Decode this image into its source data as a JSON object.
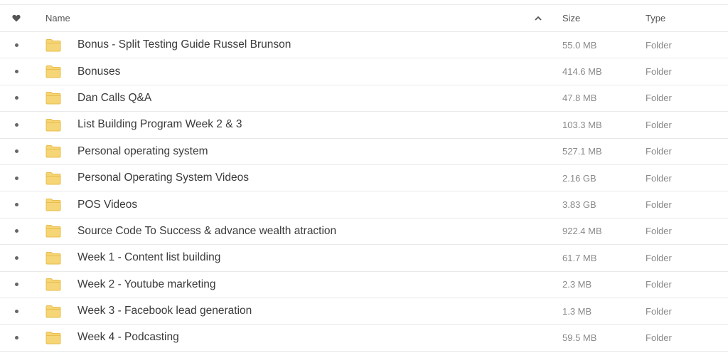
{
  "header": {
    "favorite_icon": "heart-icon",
    "name_label": "Name",
    "sort_icon": "chevron-up-icon",
    "size_label": "Size",
    "type_label": "Type"
  },
  "colors": {
    "folder_fill": "#f5d576",
    "folder_stroke": "#e8bd4a",
    "row_border": "#e9e9e9",
    "text_primary": "#3a3a3a",
    "text_secondary": "#8a8a8a"
  },
  "rows": [
    {
      "name": "Bonus - Split Testing Guide Russel Brunson",
      "size": "55.0 MB",
      "type": "Folder",
      "icon": "folder-icon"
    },
    {
      "name": "Bonuses",
      "size": "414.6 MB",
      "type": "Folder",
      "icon": "folder-icon"
    },
    {
      "name": "Dan Calls Q&A",
      "size": "47.8 MB",
      "type": "Folder",
      "icon": "folder-icon"
    },
    {
      "name": "List Building Program Week 2 & 3",
      "size": "103.3 MB",
      "type": "Folder",
      "icon": "folder-icon"
    },
    {
      "name": "Personal operating system",
      "size": "527.1 MB",
      "type": "Folder",
      "icon": "folder-icon"
    },
    {
      "name": "Personal Operating System Videos",
      "size": "2.16 GB",
      "type": "Folder",
      "icon": "folder-icon"
    },
    {
      "name": "POS Videos",
      "size": "3.83 GB",
      "type": "Folder",
      "icon": "folder-icon"
    },
    {
      "name": "Source Code To Success & advance wealth atraction",
      "size": "922.4 MB",
      "type": "Folder",
      "icon": "folder-icon"
    },
    {
      "name": "Week 1 - Content list building",
      "size": "61.7 MB",
      "type": "Folder",
      "icon": "folder-icon"
    },
    {
      "name": "Week 2 - Youtube marketing",
      "size": "2.3 MB",
      "type": "Folder",
      "icon": "folder-icon"
    },
    {
      "name": "Week 3 - Facebook lead generation",
      "size": "1.3 MB",
      "type": "Folder",
      "icon": "folder-icon"
    },
    {
      "name": "Week 4 - Podcasting",
      "size": "59.5 MB",
      "type": "Folder",
      "icon": "folder-icon"
    }
  ]
}
